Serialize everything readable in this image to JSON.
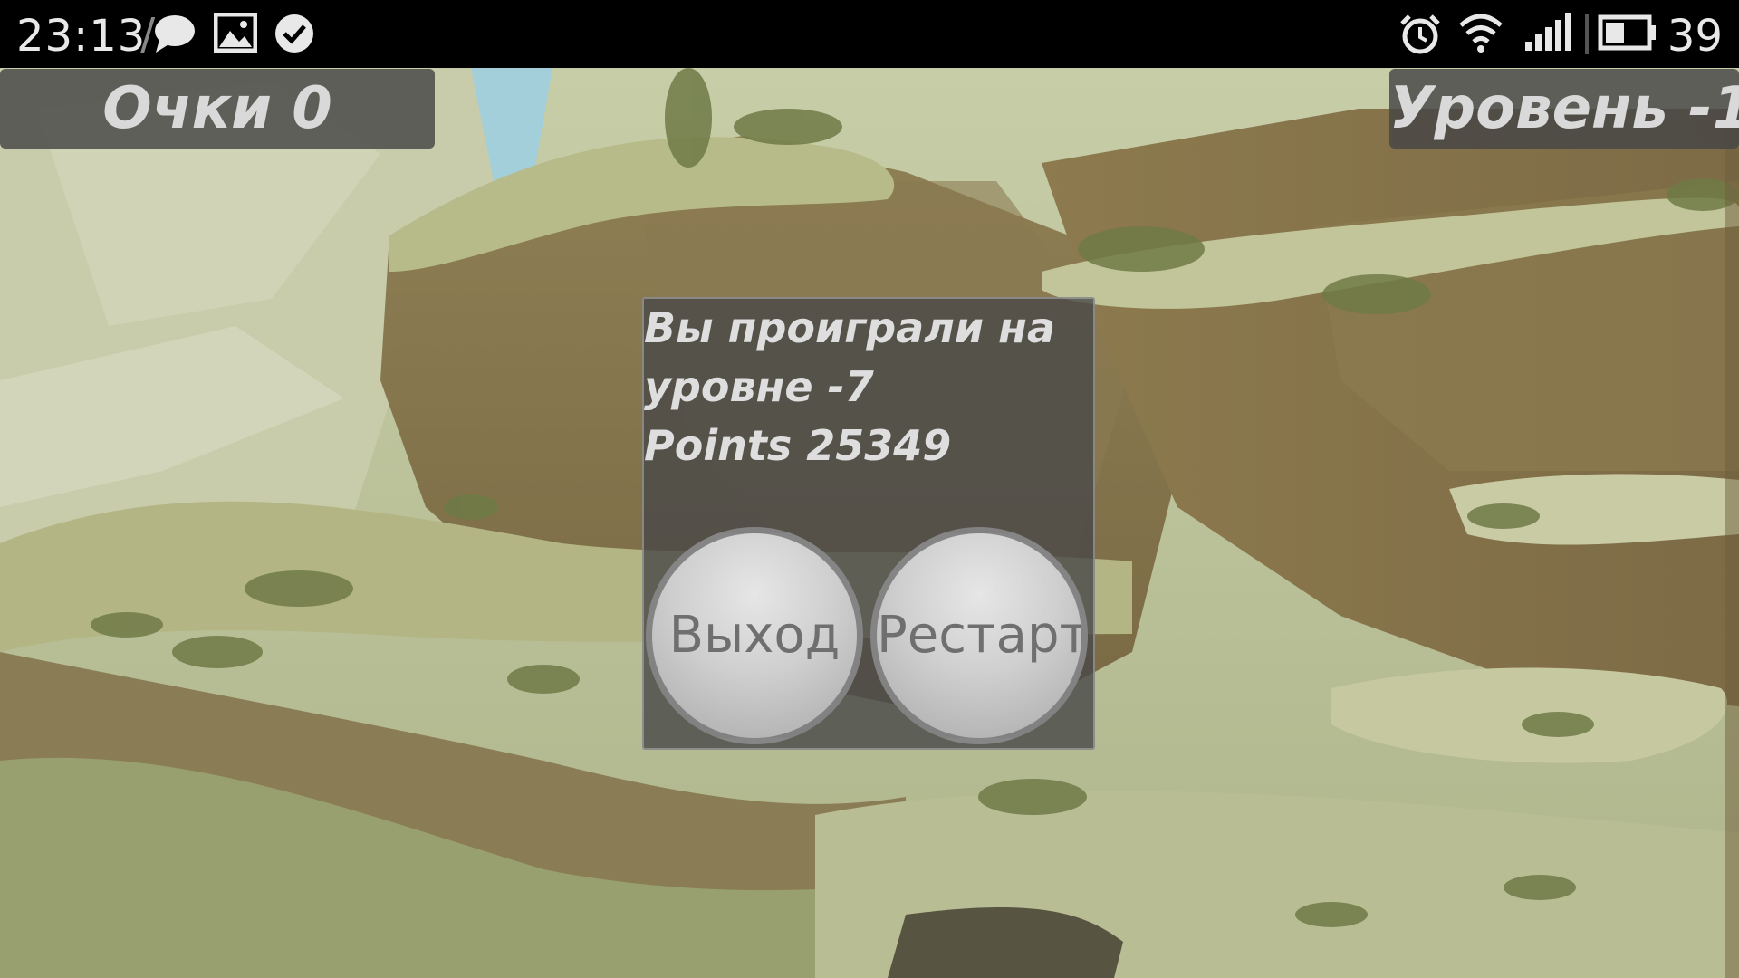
{
  "status_bar": {
    "time": "23:13",
    "battery_percent": "39",
    "icons": [
      "chat-icon",
      "image-icon",
      "check-circle-icon",
      "alarm-icon",
      "wifi-icon",
      "signal-icon",
      "battery-icon"
    ]
  },
  "hud": {
    "score_label": "Очки 0",
    "level_label": "Уровень -1"
  },
  "dialog": {
    "message_line1": "Вы проиграли на",
    "message_line2": "уровне -7",
    "points_line": "Points 25349",
    "exit_button": "Выход",
    "restart_button": "Рестарт"
  },
  "colors": {
    "status_bar_bg": "#000000",
    "hud_panel_bg": "#464646",
    "hud_text": "#d9d9d9",
    "dialog_bg": "#484848",
    "button_face": "#cfcfcf",
    "button_text": "#6f6f6f"
  }
}
